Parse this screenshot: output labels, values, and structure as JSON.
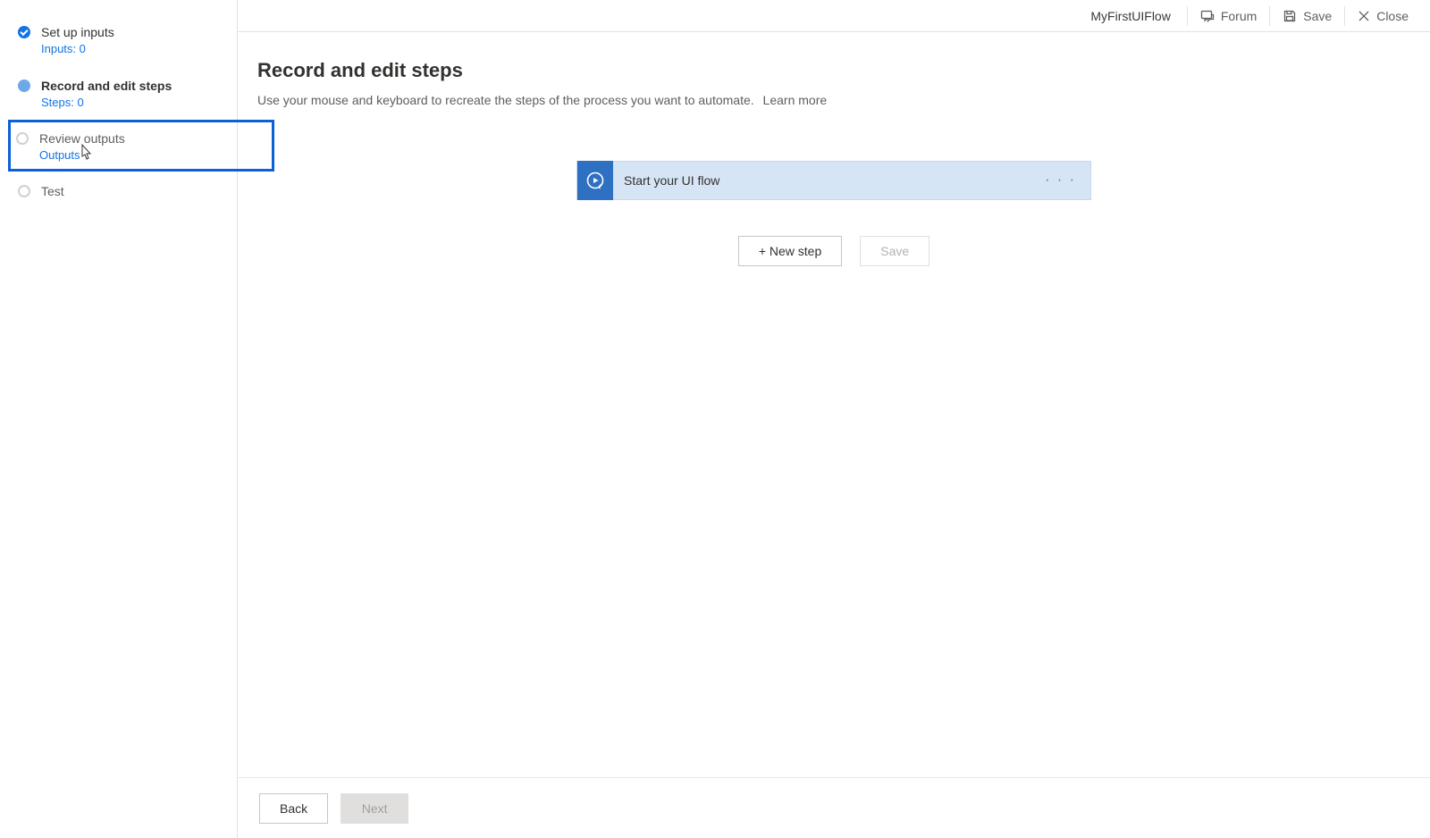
{
  "header": {
    "flow_name": "MyFirstUIFlow",
    "forum_label": "Forum",
    "save_label": "Save",
    "close_label": "Close"
  },
  "sidebar": {
    "steps": [
      {
        "label": "Set up inputs",
        "sub": "Inputs: 0",
        "state": "done"
      },
      {
        "label": "Record and edit steps",
        "sub": "Steps: 0",
        "state": "active"
      },
      {
        "label": "Review outputs",
        "sub": "Outputs",
        "state": "pending",
        "highlight": true
      },
      {
        "label": "Test",
        "sub": "",
        "state": "pending"
      }
    ]
  },
  "main": {
    "title": "Record and edit steps",
    "description": "Use your mouse and keyboard to recreate the steps of the process you want to automate.",
    "learn_more": "Learn more",
    "flow_step_label": "Start your UI flow",
    "new_step_label": "+ New step",
    "save_label": "Save"
  },
  "footer": {
    "back_label": "Back",
    "next_label": "Next"
  }
}
